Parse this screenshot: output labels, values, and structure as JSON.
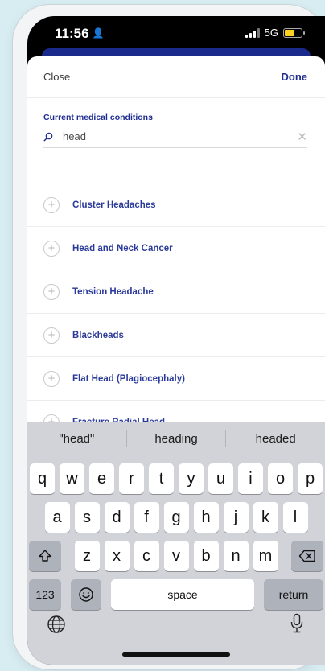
{
  "status": {
    "time": "11:56",
    "network": "5G"
  },
  "header": {
    "close_label": "Close",
    "done_label": "Done"
  },
  "search": {
    "label": "Current medical conditions",
    "value": "head",
    "clear_symbol": "✕"
  },
  "results": [
    {
      "label": "Cluster Headaches"
    },
    {
      "label": "Head and Neck Cancer"
    },
    {
      "label": "Tension Headache"
    },
    {
      "label": "Blackheads"
    },
    {
      "label": "Flat Head (Plagiocephaly)"
    },
    {
      "label": "Fracture Radial Head"
    }
  ],
  "keyboard": {
    "suggestions": [
      "\"head\"",
      "heading",
      "headed"
    ],
    "row1": [
      "q",
      "w",
      "e",
      "r",
      "t",
      "y",
      "u",
      "i",
      "o",
      "p"
    ],
    "row2": [
      "a",
      "s",
      "d",
      "f",
      "g",
      "h",
      "j",
      "k",
      "l"
    ],
    "row3": [
      "z",
      "x",
      "c",
      "v",
      "b",
      "n",
      "m"
    ],
    "numbers_label": "123",
    "space_label": "space",
    "return_label": "return"
  },
  "colors": {
    "accent": "#1e2d8f",
    "keyboard_bg": "#d1d3d9",
    "battery": "#ffd21f"
  }
}
